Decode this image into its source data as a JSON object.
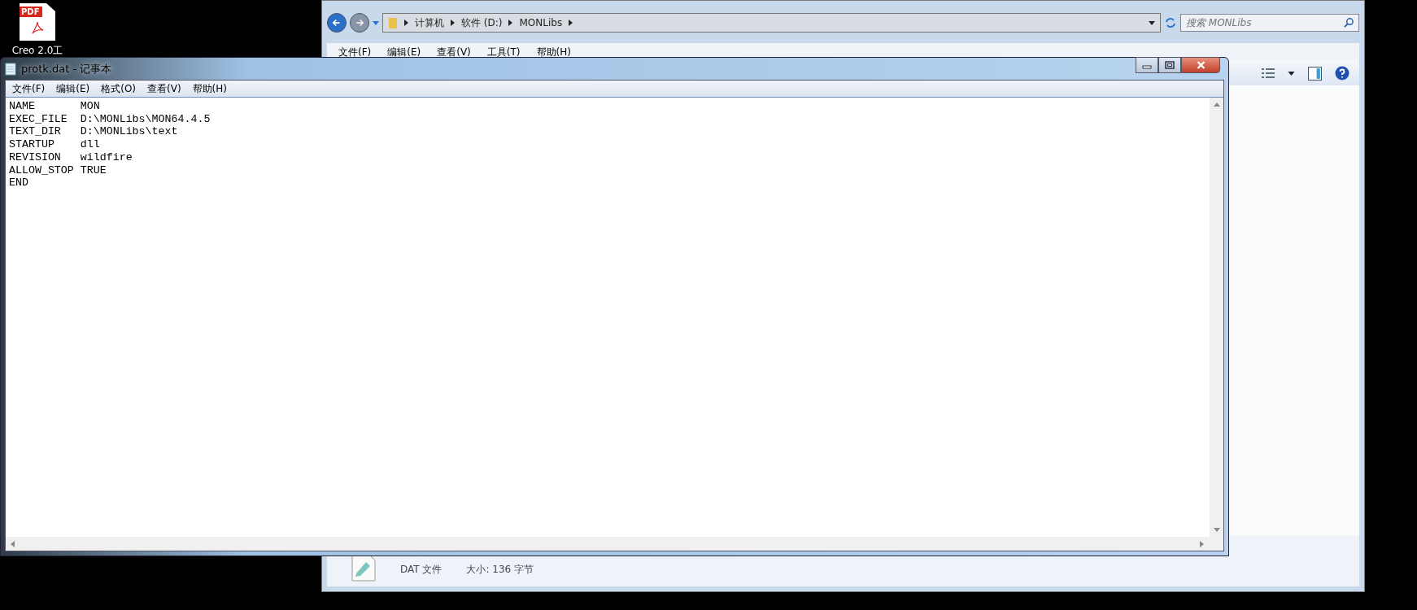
{
  "desktop_icon": {
    "badge": "PDF",
    "label": "Creo 2.0工"
  },
  "explorer": {
    "breadcrumb": [
      "计算机",
      "软件 (D:)",
      "MONLibs"
    ],
    "search": {
      "placeholder": "搜索 MONLibs"
    },
    "menu": [
      "文件(F)",
      "编辑(E)",
      "查看(V)",
      "工具(T)",
      "帮助(H)"
    ],
    "details": {
      "file_type": "DAT 文件",
      "size": "大小: 136 字节"
    }
  },
  "notepad": {
    "title": "protk.dat - 记事本",
    "menu": [
      "文件(F)",
      "编辑(E)",
      "格式(O)",
      "查看(V)",
      "帮助(H)"
    ],
    "lines": [
      "NAME       MON",
      "EXEC_FILE  D:\\MONLibs\\MON64.4.5",
      "TEXT_DIR   D:\\MONLibs\\text",
      "STARTUP    dll",
      "REVISION   wildfire",
      "ALLOW_STOP TRUE",
      "END"
    ]
  }
}
